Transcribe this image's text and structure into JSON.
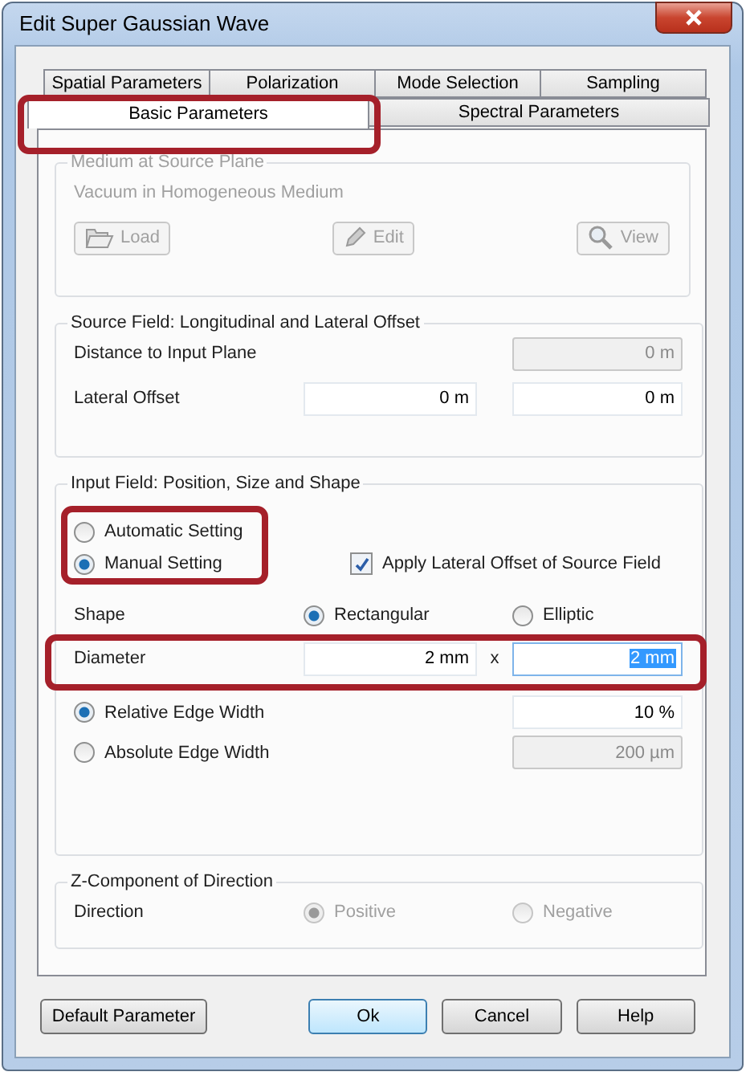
{
  "window": {
    "title": "Edit Super Gaussian Wave"
  },
  "tabs": {
    "row_1": [
      {
        "label": "Spatial Parameters",
        "selected": false
      },
      {
        "label": "Polarization",
        "selected": false
      },
      {
        "label": "Mode Selection",
        "selected": false
      },
      {
        "label": "Sampling",
        "selected": false
      }
    ],
    "row_2": [
      {
        "label": "Basic Parameters",
        "selected": true,
        "highlighted": true
      },
      {
        "label": "Spectral Parameters",
        "selected": false,
        "highlighted": false
      }
    ]
  },
  "medium": {
    "title": "Medium at Source Plane",
    "disabled": true,
    "description": "Vacuum in Homogeneous Medium",
    "buttons": [
      {
        "label": "Load",
        "kind": "folder"
      },
      {
        "label": "Edit",
        "kind": "pencil"
      },
      {
        "label": "View",
        "kind": "search"
      }
    ]
  },
  "source_field": {
    "title": "Source Field: Longitudinal and Lateral Offset",
    "rows": [
      {
        "label": "Distance to Input Plane",
        "values": [
          {
            "value": "0 m",
            "disabled": true
          }
        ]
      },
      {
        "label": "Lateral Offset",
        "values": [
          {
            "value": "0 m",
            "disabled": false
          },
          {
            "value": "0 m",
            "disabled": false
          }
        ]
      }
    ]
  },
  "input_field": {
    "title": "Input Field: Position, Size and Shape",
    "settings_highlighted": true,
    "settings": [
      {
        "label": "Automatic Setting",
        "selected": false
      },
      {
        "label": "Manual Setting",
        "selected": true
      }
    ],
    "apply_offset": {
      "label": "Apply Lateral Offset of Source Field",
      "checked": true
    },
    "shape": {
      "label": "Shape",
      "options": [
        {
          "label": "Rectangular",
          "selected": true
        },
        {
          "label": "Elliptic",
          "selected": false
        }
      ]
    },
    "diameter": {
      "label": "Diameter",
      "highlighted": true,
      "separator": "x",
      "values": [
        {
          "value": "2 mm",
          "text_selected": false
        },
        {
          "value": "2 mm",
          "text_selected": true
        }
      ]
    },
    "edge": [
      {
        "label": "Relative Edge Width",
        "selected": true,
        "value": "10 %",
        "disabled": false
      },
      {
        "label": "Absolute Edge Width",
        "selected": false,
        "value": "200 µm",
        "disabled": true
      }
    ]
  },
  "z_component": {
    "title": "Z-Component of Direction",
    "label": "Direction",
    "disabled": true,
    "options": [
      {
        "label": "Positive",
        "selected": true
      },
      {
        "label": "Negative",
        "selected": false
      }
    ]
  },
  "buttons": [
    {
      "label": "Default Parameter",
      "default": false
    },
    {
      "label": "Ok",
      "default": true
    },
    {
      "label": "Cancel",
      "default": false
    },
    {
      "label": "Help",
      "default": false
    }
  ]
}
